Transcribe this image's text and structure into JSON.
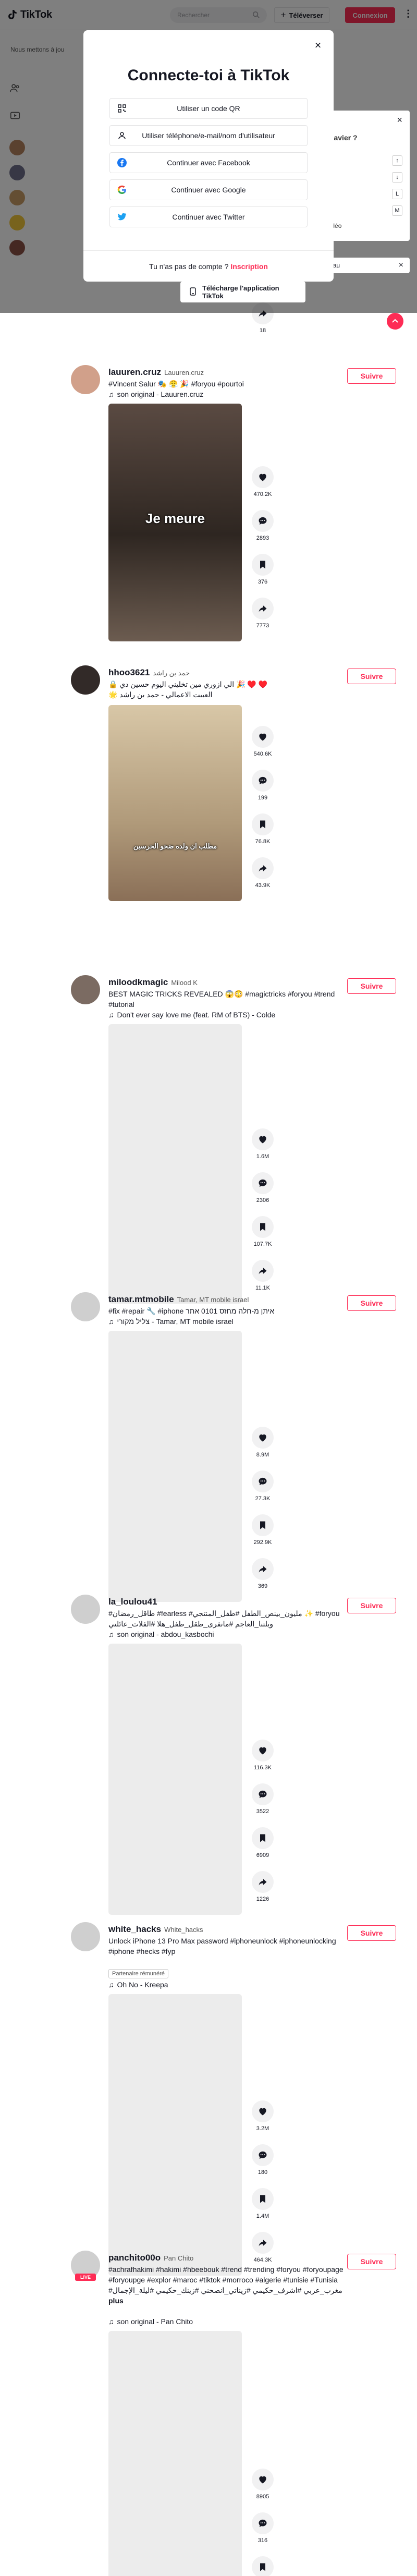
{
  "app": {
    "brand": "TikTok",
    "accent": "#fe2c55"
  },
  "header": {
    "search_placeholder": "Rechercher",
    "upload_label": "Téléverser",
    "login_label": "Connexion"
  },
  "rail": {
    "suggested_label": "Nous mettons à jou",
    "follow_tail": "ok"
  },
  "modal": {
    "title": "Connecte-toi à TikTok",
    "options": [
      {
        "label": "Utiliser un code QR",
        "icon": "qr-code-icon"
      },
      {
        "label": "Utiliser téléphone/e-mail/nom d'utilisateur",
        "icon": "user-icon"
      },
      {
        "label": "Continuer avec Facebook",
        "icon": "facebook-icon"
      },
      {
        "label": "Continuer avec Google",
        "icon": "google-icon"
      },
      {
        "label": "Continuer avec Twitter",
        "icon": "twitter-icon"
      }
    ],
    "footer_text": "Tu n'as pas de compte ?",
    "footer_link": "Inscription"
  },
  "keyboard_panel": {
    "title": "rcis clavier ?",
    "rows": [
      {
        "label": "",
        "key": "↑"
      },
      {
        "label": "",
        "key": "↓"
      },
      {
        "label": "",
        "key": "L"
      },
      {
        "label": "",
        "key": "M"
      },
      {
        "label": "re le vidéo",
        "key": ""
      }
    ],
    "footer": "de bureau"
  },
  "download_bar": {
    "label": "Télécharge l'application TikTok"
  },
  "top_post_count": "18",
  "posts": [
    {
      "username": "lauuren.cruz",
      "nickname": "Lauuren.cruz",
      "caption": "#Vincent Salur 🎭 😤 🎉 #foryou #pourtoi",
      "music": "son original - Lauuren.cruz",
      "follow": "Suivre",
      "video_text": "Je meure",
      "counts": [
        "470.2K",
        "2893",
        "376",
        "7773"
      ],
      "badge": ""
    },
    {
      "username": "hhoo3621",
      "nickname": "حمد بن راشد",
      "caption": "🔒 الي ازوري مين تخليني اليوم حسين دي 🎉 ♥️ ♥️\n🌟 العبيت الاعمالي - حمد بن راشد",
      "music": "",
      "follow": "Suivre",
      "video_text": "مطلب ان ولده ضحو الحرسين",
      "counts": [
        "540.6K",
        "199",
        "76.8K",
        "43.9K"
      ],
      "badge": ""
    },
    {
      "username": "miloodkmagic",
      "nickname": "Milood K",
      "caption": "BEST MAGIC TRICKS REVEALED 😱😳 #magictricks #foryou #trend #tutorial",
      "music": "Don't ever say love me (feat. RM of BTS) - Colde",
      "follow": "Suivre",
      "video_text": "",
      "counts": [
        "1.6M",
        "2306",
        "107.7K",
        "11.1K"
      ],
      "badge": ""
    },
    {
      "username": "tamar.mtmobile",
      "nickname": "Tamar, MT mobile israel",
      "caption": "#fix #repair 🔧 #iphone איתן מ-חלה מחזס 0101 אתר",
      "music": "צליל מקורי - Tamar, MT mobile israel",
      "follow": "Suivre",
      "video_text": "",
      "counts": [
        "8.9M",
        "27.3K",
        "292.9K",
        "369"
      ],
      "badge": ""
    },
    {
      "username": "la_loulou41",
      "nickname": "",
      "caption": "#طاقل_رمضان #fearless #مليون_بينص_الطفل #طفل_المنتجي ✨ #foryou ويلتنا_العاجم #مانفرى_طقل_طفل_هلا #الفلات_عائلتي",
      "music": "son original - abdou_kasbochi",
      "follow": "Suivre",
      "video_text": "",
      "counts": [
        "116.3K",
        "3522",
        "6909",
        "1226"
      ],
      "badge": ""
    },
    {
      "username": "white_hacks",
      "nickname": "White_hacks",
      "caption": "Unlock iPhone 13 Pro Max password #iphoneunlock #iphoneunlocking #iphone #hecks #fyp",
      "music": "Oh No - Kreepa",
      "follow": "Suivre",
      "video_text": "",
      "counts": [
        "3.2M",
        "180",
        "1.4M",
        "464.3K"
      ],
      "badge": "Partenaire rémunéré"
    },
    {
      "username": "panchito00o",
      "nickname": "Pan Chito",
      "caption": "#achrafhakimi #hakimi #hbeebouk #trend #trending #foryou #foryoupage #foryoupge #explor #maroc #tiktok #morroco #algerie #tunisie #Tunisia #مغرب_عربي #اشرف_حكيمي #زيناتي_انصحني #زينك_حكيمي #ليلة_الإجمال",
      "music": "son original - Pan Chito",
      "follow": "Suivre",
      "more": "plus",
      "video_text": "",
      "counts": [
        "8905",
        "316",
        "991",
        "599"
      ],
      "badge": "",
      "live": "LIVE"
    }
  ]
}
